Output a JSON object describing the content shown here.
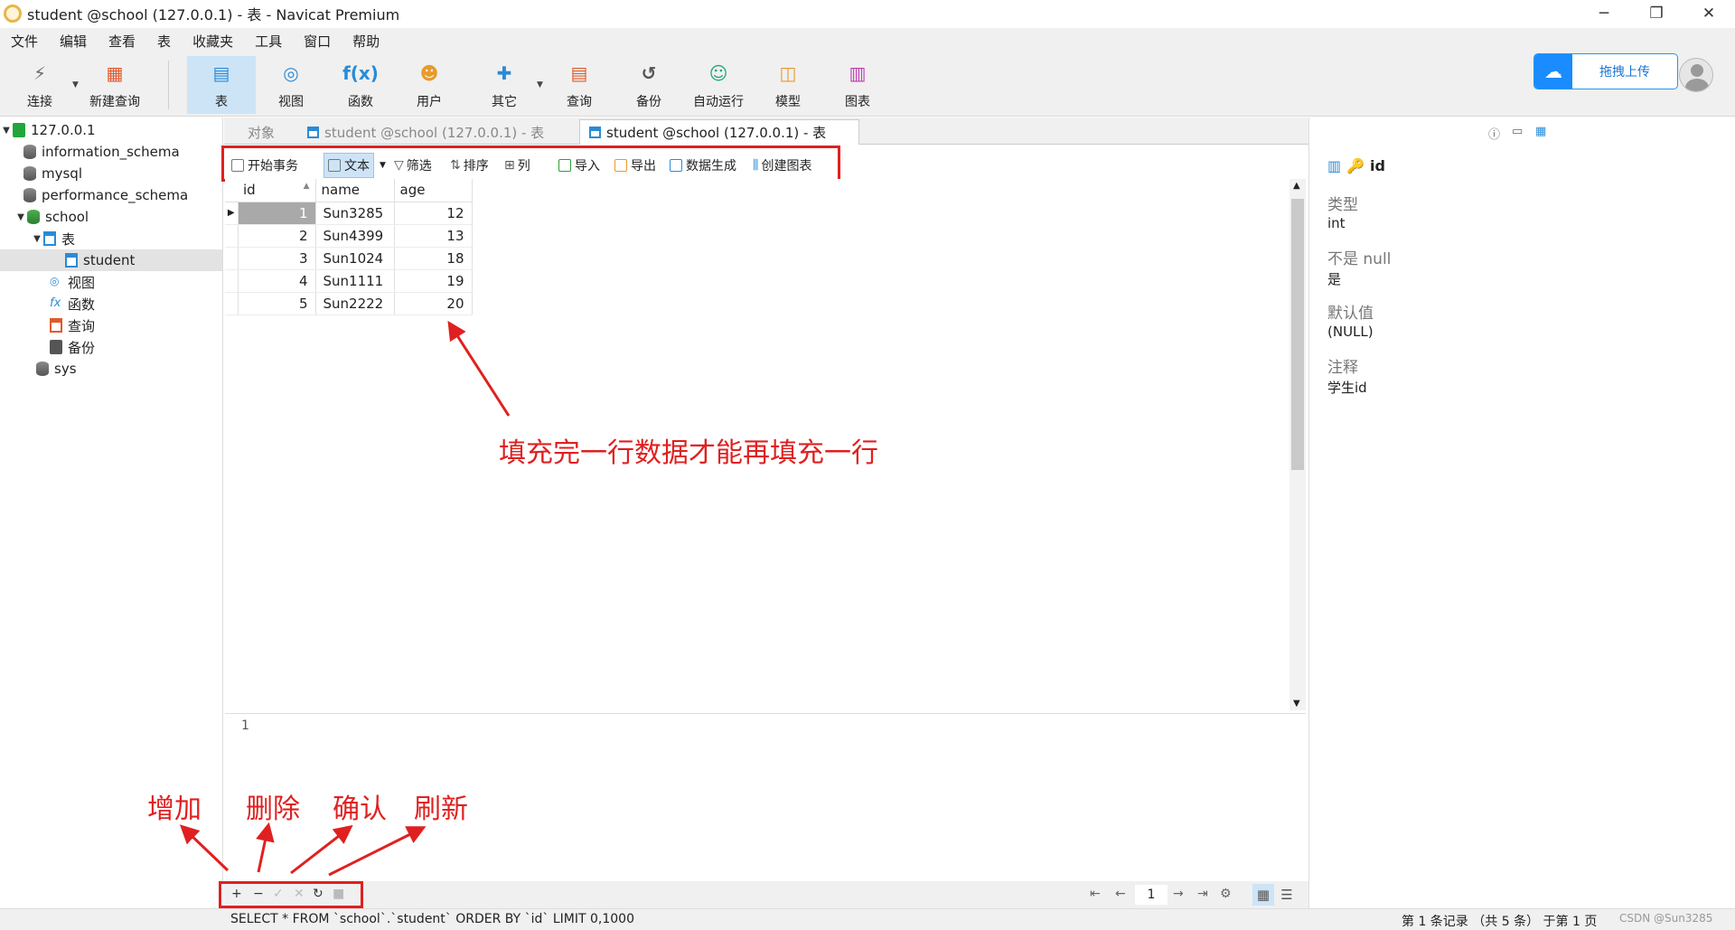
{
  "window": {
    "title": "student @school (127.0.0.1) - 表 - Navicat Premium",
    "minimize": "─",
    "restore": "❐",
    "close": "✕"
  },
  "menu": [
    "文件",
    "编辑",
    "查看",
    "表",
    "收藏夹",
    "工具",
    "窗口",
    "帮助"
  ],
  "toolbar": [
    {
      "label": "连接",
      "icon": "plug-icon",
      "glyph": "⚡",
      "color": "#6c6c6c"
    },
    {
      "label": "新建查询",
      "icon": "new-query-icon",
      "glyph": "▦",
      "color": "#e05a2a"
    },
    {
      "label": "表",
      "icon": "table-icon",
      "glyph": "▤",
      "color": "#2a8bd6"
    },
    {
      "label": "视图",
      "icon": "view-icon",
      "glyph": "◎",
      "color": "#2a8bd6"
    },
    {
      "label": "函数",
      "icon": "function-icon",
      "glyph": "f(x)",
      "color": "#2a8bd6"
    },
    {
      "label": "用户",
      "icon": "user-icon",
      "glyph": "☻",
      "color": "#e89a2a"
    },
    {
      "label": "其它",
      "icon": "tools-icon",
      "glyph": "✚",
      "color": "#2a8bd6"
    },
    {
      "label": "查询",
      "icon": "query-icon",
      "glyph": "▤",
      "color": "#e05a2a"
    },
    {
      "label": "备份",
      "icon": "backup-icon",
      "glyph": "↺",
      "color": "#555555"
    },
    {
      "label": "自动运行",
      "icon": "robot-icon",
      "glyph": "☺",
      "color": "#21a67a"
    },
    {
      "label": "模型",
      "icon": "model-icon",
      "glyph": "◫",
      "color": "#e89a2a"
    },
    {
      "label": "图表",
      "icon": "chart-icon",
      "glyph": "▥",
      "color": "#c03ab0"
    }
  ],
  "cloud": {
    "label": "拖拽上传"
  },
  "tree": [
    {
      "label": "127.0.0.1",
      "type": "server",
      "expanded": true
    },
    {
      "label": "information_schema",
      "type": "db"
    },
    {
      "label": "mysql",
      "type": "db"
    },
    {
      "label": "performance_schema",
      "type": "db"
    },
    {
      "label": "school",
      "type": "db-open",
      "expanded": true
    },
    {
      "label": "表",
      "type": "folder-table",
      "expanded": true
    },
    {
      "label": "student",
      "type": "table",
      "selected": true
    },
    {
      "label": "视图",
      "type": "folder-view"
    },
    {
      "label": "函数",
      "type": "folder-func"
    },
    {
      "label": "查询",
      "type": "folder-query"
    },
    {
      "label": "备份",
      "type": "folder-backup"
    },
    {
      "label": "sys",
      "type": "db"
    }
  ],
  "tabs": {
    "objects": "对象",
    "tab1": "student @school (127.0.0.1) - 表",
    "tab2": "student @school (127.0.0.1) - 表"
  },
  "objbar": [
    "开始事务",
    "文本",
    "筛选",
    "排序",
    "列",
    "导入",
    "导出",
    "数据生成",
    "创建图表"
  ],
  "grid": {
    "columns": [
      "id",
      "name",
      "age"
    ],
    "rows": [
      [
        "1",
        "Sun3285",
        "12"
      ],
      [
        "2",
        "Sun4399",
        "13"
      ],
      [
        "3",
        "Sun1024",
        "18"
      ],
      [
        "4",
        "Sun1111",
        "19"
      ],
      [
        "5",
        "Sun2222",
        "20"
      ]
    ]
  },
  "preview_value": "1",
  "nav": {
    "add": "+",
    "delete": "−",
    "confirm": "✓",
    "cancel": "✕",
    "refresh": "↻",
    "stop": "■",
    "first": "⇤",
    "prev": "←",
    "page": "1",
    "next": "→",
    "last": "⇥",
    "settings": "⚙"
  },
  "status": {
    "sql": "SELECT * FROM `school`.`student` ORDER BY `id` LIMIT 0,1000",
    "records": "第 1 条记录 （共 5 条） 于第 1 页",
    "watermark": "CSDN @Sun3285"
  },
  "panel": {
    "field": "id",
    "props": [
      {
        "label": "类型",
        "value": "int"
      },
      {
        "label": "不是 null",
        "value": "是"
      },
      {
        "label": "默认值",
        "value": "(NULL)"
      },
      {
        "label": "注释",
        "value": "学生id"
      }
    ]
  },
  "annotations": {
    "note": "填充完一行数据才能再填充一行",
    "add": "增加",
    "delete": "删除",
    "confirm": "确认",
    "refresh": "刷新"
  },
  "colors": {
    "accent": "#2a8bd6",
    "annotation": "#e02020",
    "selection": "#cde4f7"
  }
}
